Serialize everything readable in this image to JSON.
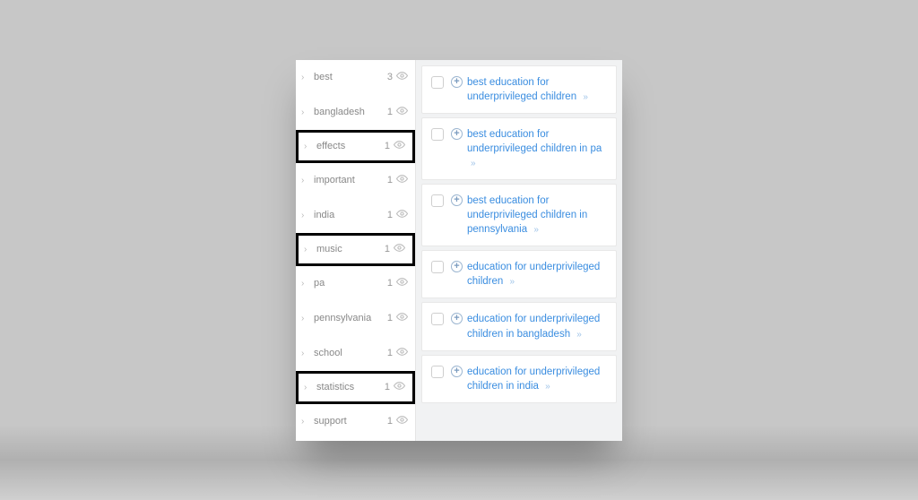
{
  "sidebar": {
    "items": [
      {
        "label": "best",
        "count": "3",
        "highlighted": false
      },
      {
        "label": "bangladesh",
        "count": "1",
        "highlighted": false
      },
      {
        "label": "effects",
        "count": "1",
        "highlighted": true
      },
      {
        "label": "important",
        "count": "1",
        "highlighted": false
      },
      {
        "label": "india",
        "count": "1",
        "highlighted": false
      },
      {
        "label": "music",
        "count": "1",
        "highlighted": true
      },
      {
        "label": "pa",
        "count": "1",
        "highlighted": false
      },
      {
        "label": "pennsylvania",
        "count": "1",
        "highlighted": false
      },
      {
        "label": "school",
        "count": "1",
        "highlighted": false
      },
      {
        "label": "statistics",
        "count": "1",
        "highlighted": true
      },
      {
        "label": "support",
        "count": "1",
        "highlighted": false
      }
    ]
  },
  "results": {
    "items": [
      {
        "text": "best education for underprivileged children"
      },
      {
        "text": "best education for underprivileged children in pa"
      },
      {
        "text": "best education for underprivileged children in pennsylvania"
      },
      {
        "text": "education for underprivileged children"
      },
      {
        "text": "education for underprivileged children in bangladesh"
      },
      {
        "text": "education for underprivileged children in india"
      }
    ]
  },
  "glyphs": {
    "chevron_right": "›",
    "eye": "👁",
    "plus": "+",
    "double_chevron": "»"
  },
  "colors": {
    "link": "#3a8de0",
    "muted": "#888",
    "highlight_border": "#000000"
  }
}
